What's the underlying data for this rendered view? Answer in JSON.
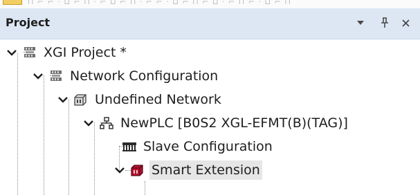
{
  "panel": {
    "title": "Project",
    "dropdown_icon": "caret-down-icon",
    "pin_icon": "pin-icon",
    "close_icon": "close-icon"
  },
  "tree": {
    "items": [
      {
        "label": "XGI Project *",
        "expanded": true,
        "icon": "project-icon"
      },
      {
        "label": "Network Configuration",
        "expanded": true,
        "icon": "network-configuration-icon"
      },
      {
        "label": "Undefined Network",
        "expanded": true,
        "icon": "network-cube-icon"
      },
      {
        "label": "NewPLC [B0S2 XGL-EFMT(B)(TAG)]",
        "expanded": true,
        "icon": "plc-network-icon"
      },
      {
        "label": "Slave Configuration",
        "expanded": false,
        "icon": "slave-configuration-icon"
      },
      {
        "label": "Smart Extension",
        "expanded": true,
        "icon": "smart-extension-icon",
        "selected": true
      }
    ]
  },
  "colors": {
    "header_bg": "#dde7f4",
    "selection_bg": "#e6e6e6",
    "smart_extension_icon": "#b5122f"
  }
}
